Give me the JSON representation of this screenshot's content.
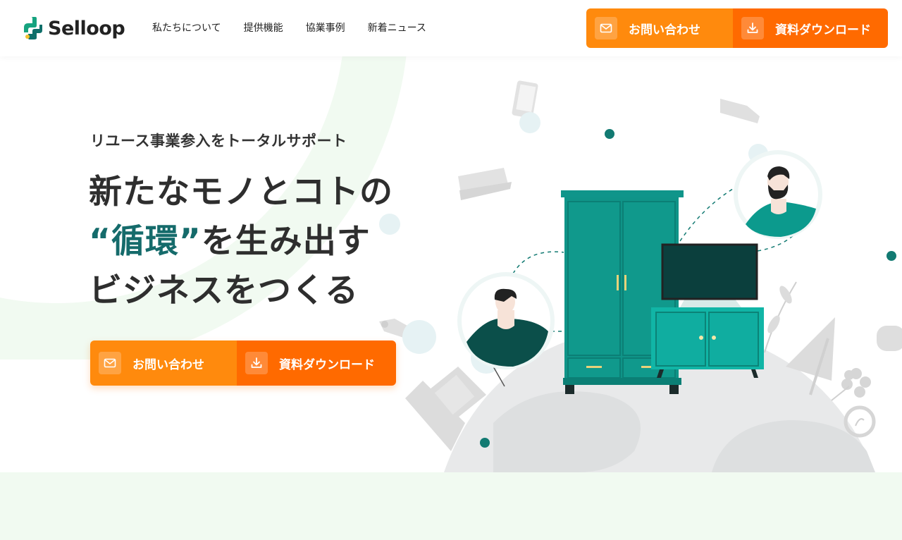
{
  "header": {
    "logo_text": "Selloop",
    "nav": [
      {
        "label": "私たちについて"
      },
      {
        "label": "提供機能"
      },
      {
        "label": "協業事例"
      },
      {
        "label": "新着ニュース"
      }
    ],
    "cta_contact": "お問い合わせ",
    "cta_download": "資料ダウンロード"
  },
  "hero": {
    "subtitle": "リユース事業参入をトータルサポート",
    "title_line1": "新たなモノとコトの",
    "title_accent": "“循環”",
    "title_line2_rest": "を生み出す",
    "title_line3": "ビジネスをつくる",
    "cta_contact": "お問い合わせ",
    "cta_download": "資料ダウンロード"
  },
  "colors": {
    "brand_teal": "#156b6b",
    "orange_light": "#ff8a0d",
    "orange_dark": "#ff6a00",
    "mint_bg": "#f1faf1"
  },
  "icons": [
    "mail-icon",
    "download-icon",
    "logo-icon"
  ]
}
